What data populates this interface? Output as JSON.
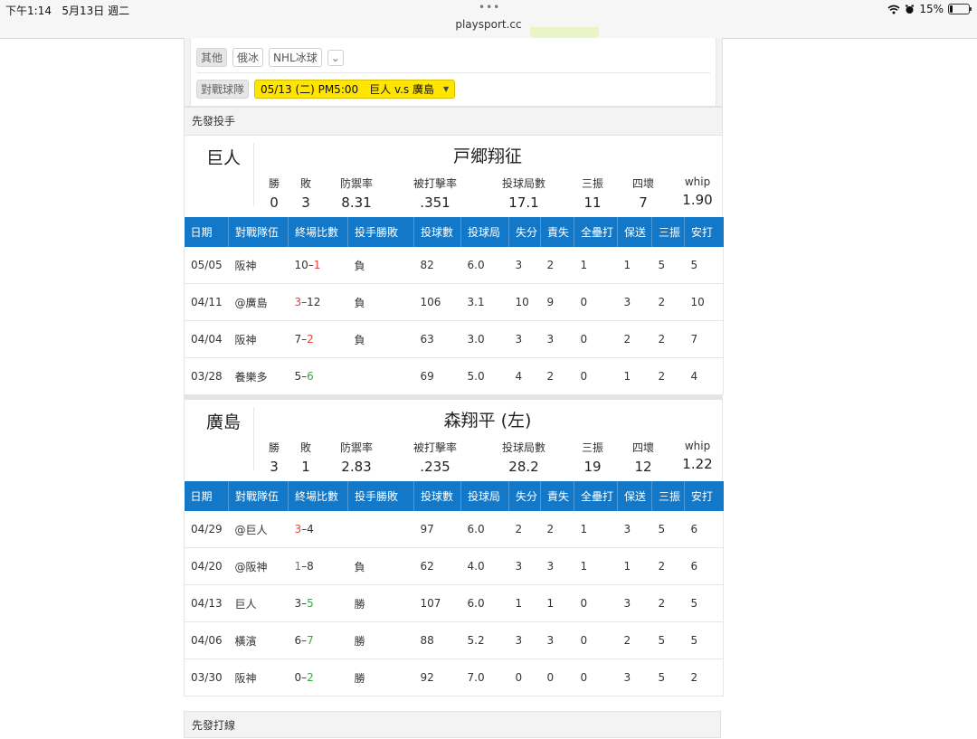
{
  "status_bar": {
    "time": "下午1:14",
    "date": "5月13日 週二",
    "dots": "•••",
    "url": "playsport.cc",
    "battery": "15%",
    "battery_level": 0.15
  },
  "filters": {
    "other_label": "其他",
    "other_chip1": "俄冰",
    "other_chip2": "NHL冰球",
    "expand_icon": "chevron-down-icon",
    "matchup_label": "對戰球隊",
    "matchup_value": "05/13 (二) PM5:00　巨人 v.s 廣島"
  },
  "sections": {
    "starting_pitcher": "先發投手",
    "starting_lineup": "先發打線"
  },
  "stat_labels": {
    "w": "勝",
    "l": "敗",
    "era": "防禦率",
    "baa": "被打擊率",
    "ip": "投球局數",
    "so": "三振",
    "bb": "四壞",
    "whip": "whip"
  },
  "table_headers": [
    "日期",
    "對戰隊伍",
    "終場比數",
    "投手勝敗",
    "投球數",
    "投球局",
    "失分",
    "責失",
    "全壘打",
    "保送",
    "三振",
    "安打"
  ],
  "pitchers": [
    {
      "team": "巨人",
      "name": "戸郷翔征",
      "stats": {
        "w": "0",
        "l": "3",
        "era": "8.31",
        "baa": ".351",
        "ip": "17.1",
        "so": "11",
        "bb": "7",
        "whip": "1.90"
      },
      "games": [
        {
          "date": "05/05",
          "opp": "阪神",
          "s1": "10",
          "dash": "–",
          "s2": "1",
          "s1c": "",
          "s2c": "red",
          "dec": "負",
          "decc": "red",
          "pc": "82",
          "ip": "6.0",
          "r": "3",
          "er": "2",
          "hr": "1",
          "bb": "1",
          "so": "5",
          "h": "5"
        },
        {
          "date": "04/11",
          "opp": "@廣島",
          "s1": "3",
          "dash": "–",
          "s2": "12",
          "s1c": "red",
          "s2c": "",
          "dec": "負",
          "decc": "red",
          "pc": "106",
          "ip": "3.1",
          "r": "10",
          "er": "9",
          "hr": "0",
          "bb": "3",
          "so": "2",
          "h": "10"
        },
        {
          "date": "04/04",
          "opp": "阪神",
          "s1": "7",
          "dash": "–",
          "s2": "2",
          "s1c": "",
          "s2c": "red",
          "dec": "負",
          "decc": "red",
          "pc": "63",
          "ip": "3.0",
          "r": "3",
          "er": "3",
          "hr": "0",
          "bb": "2",
          "so": "2",
          "h": "7"
        },
        {
          "date": "03/28",
          "opp": "養樂多",
          "s1": "5",
          "dash": "–",
          "s2": "6",
          "s1c": "",
          "s2c": "green",
          "dec": "",
          "decc": "",
          "pc": "69",
          "ip": "5.0",
          "r": "4",
          "er": "2",
          "hr": "0",
          "bb": "1",
          "so": "2",
          "h": "4"
        }
      ]
    },
    {
      "team": "廣島",
      "name": "森翔平 (左)",
      "stats": {
        "w": "3",
        "l": "1",
        "era": "2.83",
        "baa": ".235",
        "ip": "28.2",
        "so": "19",
        "bb": "12",
        "whip": "1.22"
      },
      "games": [
        {
          "date": "04/29",
          "opp": "@巨人",
          "s1": "3",
          "dash": "–",
          "s2": "4",
          "s1c": "red",
          "s2c": "",
          "dec": "",
          "decc": "",
          "pc": "97",
          "ip": "6.0",
          "r": "2",
          "er": "2",
          "hr": "1",
          "bb": "3",
          "so": "5",
          "h": "6"
        },
        {
          "date": "04/20",
          "opp": "@阪神",
          "s1": "1",
          "dash": "–",
          "s2": "8",
          "s1c": "red",
          "s2c": "",
          "dec": "負",
          "decc": "red",
          "pc": "62",
          "ip": "4.0",
          "r": "3",
          "er": "3",
          "hr": "1",
          "bb": "1",
          "so": "2",
          "h": "6"
        },
        {
          "date": "04/13",
          "opp": "巨人",
          "s1": "3",
          "dash": "–",
          "s2": "5",
          "s1c": "",
          "s2c": "green",
          "dec": "勝",
          "decc": "green",
          "pc": "107",
          "ip": "6.0",
          "r": "1",
          "er": "1",
          "hr": "0",
          "bb": "3",
          "so": "2",
          "h": "5"
        },
        {
          "date": "04/06",
          "opp": "橫濱",
          "s1": "6",
          "dash": "–",
          "s2": "7",
          "s1c": "",
          "s2c": "green",
          "dec": "勝",
          "decc": "green",
          "pc": "88",
          "ip": "5.2",
          "r": "3",
          "er": "3",
          "hr": "0",
          "bb": "2",
          "so": "5",
          "h": "5"
        },
        {
          "date": "03/30",
          "opp": "阪神",
          "s1": "0",
          "dash": "–",
          "s2": "2",
          "s1c": "",
          "s2c": "green",
          "dec": "勝",
          "decc": "green",
          "pc": "92",
          "ip": "7.0",
          "r": "0",
          "er": "0",
          "hr": "0",
          "bb": "3",
          "so": "5",
          "h": "2"
        }
      ]
    }
  ],
  "colors": {
    "header_blue": "#1378c7",
    "loss_red": "#e0443a",
    "win_green": "#3aa64a",
    "select_yellow": "#ffe500"
  }
}
